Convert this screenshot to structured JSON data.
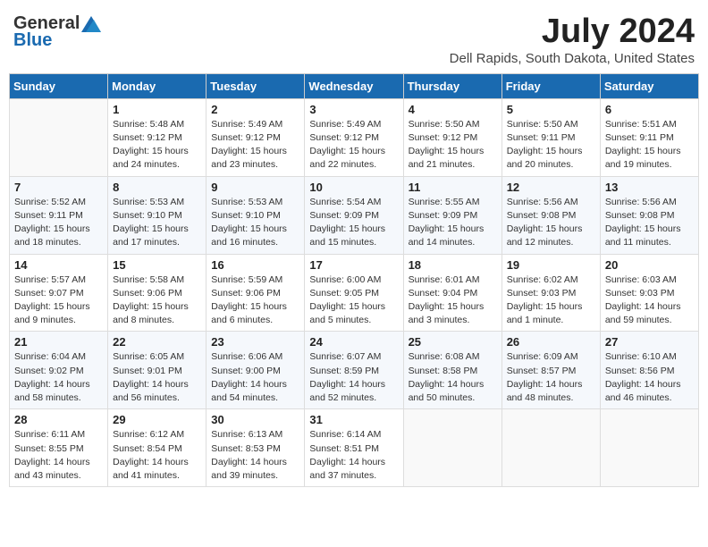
{
  "header": {
    "logo_general": "General",
    "logo_blue": "Blue",
    "month_year": "July 2024",
    "location": "Dell Rapids, South Dakota, United States"
  },
  "weekdays": [
    "Sunday",
    "Monday",
    "Tuesday",
    "Wednesday",
    "Thursday",
    "Friday",
    "Saturday"
  ],
  "weeks": [
    [
      {
        "day": "",
        "info": ""
      },
      {
        "day": "1",
        "info": "Sunrise: 5:48 AM\nSunset: 9:12 PM\nDaylight: 15 hours\nand 24 minutes."
      },
      {
        "day": "2",
        "info": "Sunrise: 5:49 AM\nSunset: 9:12 PM\nDaylight: 15 hours\nand 23 minutes."
      },
      {
        "day": "3",
        "info": "Sunrise: 5:49 AM\nSunset: 9:12 PM\nDaylight: 15 hours\nand 22 minutes."
      },
      {
        "day": "4",
        "info": "Sunrise: 5:50 AM\nSunset: 9:12 PM\nDaylight: 15 hours\nand 21 minutes."
      },
      {
        "day": "5",
        "info": "Sunrise: 5:50 AM\nSunset: 9:11 PM\nDaylight: 15 hours\nand 20 minutes."
      },
      {
        "day": "6",
        "info": "Sunrise: 5:51 AM\nSunset: 9:11 PM\nDaylight: 15 hours\nand 19 minutes."
      }
    ],
    [
      {
        "day": "7",
        "info": "Sunrise: 5:52 AM\nSunset: 9:11 PM\nDaylight: 15 hours\nand 18 minutes."
      },
      {
        "day": "8",
        "info": "Sunrise: 5:53 AM\nSunset: 9:10 PM\nDaylight: 15 hours\nand 17 minutes."
      },
      {
        "day": "9",
        "info": "Sunrise: 5:53 AM\nSunset: 9:10 PM\nDaylight: 15 hours\nand 16 minutes."
      },
      {
        "day": "10",
        "info": "Sunrise: 5:54 AM\nSunset: 9:09 PM\nDaylight: 15 hours\nand 15 minutes."
      },
      {
        "day": "11",
        "info": "Sunrise: 5:55 AM\nSunset: 9:09 PM\nDaylight: 15 hours\nand 14 minutes."
      },
      {
        "day": "12",
        "info": "Sunrise: 5:56 AM\nSunset: 9:08 PM\nDaylight: 15 hours\nand 12 minutes."
      },
      {
        "day": "13",
        "info": "Sunrise: 5:56 AM\nSunset: 9:08 PM\nDaylight: 15 hours\nand 11 minutes."
      }
    ],
    [
      {
        "day": "14",
        "info": "Sunrise: 5:57 AM\nSunset: 9:07 PM\nDaylight: 15 hours\nand 9 minutes."
      },
      {
        "day": "15",
        "info": "Sunrise: 5:58 AM\nSunset: 9:06 PM\nDaylight: 15 hours\nand 8 minutes."
      },
      {
        "day": "16",
        "info": "Sunrise: 5:59 AM\nSunset: 9:06 PM\nDaylight: 15 hours\nand 6 minutes."
      },
      {
        "day": "17",
        "info": "Sunrise: 6:00 AM\nSunset: 9:05 PM\nDaylight: 15 hours\nand 5 minutes."
      },
      {
        "day": "18",
        "info": "Sunrise: 6:01 AM\nSunset: 9:04 PM\nDaylight: 15 hours\nand 3 minutes."
      },
      {
        "day": "19",
        "info": "Sunrise: 6:02 AM\nSunset: 9:03 PM\nDaylight: 15 hours\nand 1 minute."
      },
      {
        "day": "20",
        "info": "Sunrise: 6:03 AM\nSunset: 9:03 PM\nDaylight: 14 hours\nand 59 minutes."
      }
    ],
    [
      {
        "day": "21",
        "info": "Sunrise: 6:04 AM\nSunset: 9:02 PM\nDaylight: 14 hours\nand 58 minutes."
      },
      {
        "day": "22",
        "info": "Sunrise: 6:05 AM\nSunset: 9:01 PM\nDaylight: 14 hours\nand 56 minutes."
      },
      {
        "day": "23",
        "info": "Sunrise: 6:06 AM\nSunset: 9:00 PM\nDaylight: 14 hours\nand 54 minutes."
      },
      {
        "day": "24",
        "info": "Sunrise: 6:07 AM\nSunset: 8:59 PM\nDaylight: 14 hours\nand 52 minutes."
      },
      {
        "day": "25",
        "info": "Sunrise: 6:08 AM\nSunset: 8:58 PM\nDaylight: 14 hours\nand 50 minutes."
      },
      {
        "day": "26",
        "info": "Sunrise: 6:09 AM\nSunset: 8:57 PM\nDaylight: 14 hours\nand 48 minutes."
      },
      {
        "day": "27",
        "info": "Sunrise: 6:10 AM\nSunset: 8:56 PM\nDaylight: 14 hours\nand 46 minutes."
      }
    ],
    [
      {
        "day": "28",
        "info": "Sunrise: 6:11 AM\nSunset: 8:55 PM\nDaylight: 14 hours\nand 43 minutes."
      },
      {
        "day": "29",
        "info": "Sunrise: 6:12 AM\nSunset: 8:54 PM\nDaylight: 14 hours\nand 41 minutes."
      },
      {
        "day": "30",
        "info": "Sunrise: 6:13 AM\nSunset: 8:53 PM\nDaylight: 14 hours\nand 39 minutes."
      },
      {
        "day": "31",
        "info": "Sunrise: 6:14 AM\nSunset: 8:51 PM\nDaylight: 14 hours\nand 37 minutes."
      },
      {
        "day": "",
        "info": ""
      },
      {
        "day": "",
        "info": ""
      },
      {
        "day": "",
        "info": ""
      }
    ]
  ]
}
